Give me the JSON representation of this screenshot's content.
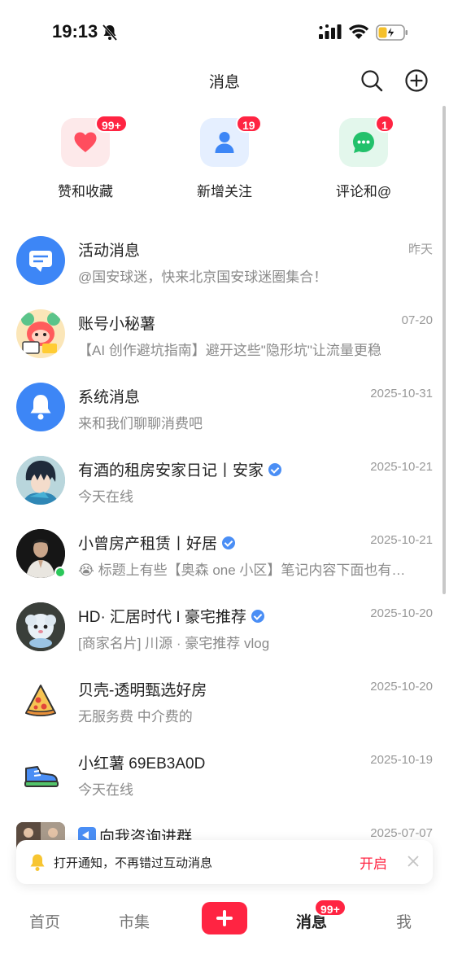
{
  "status_bar": {
    "time": "19:13"
  },
  "header": {
    "title": "消息"
  },
  "quick_actions": [
    {
      "label": "赞和收藏",
      "badge": "99+",
      "icon": "heart-icon",
      "color": "#ff4d5e"
    },
    {
      "label": "新增关注",
      "badge": "19",
      "icon": "person-icon",
      "color": "#3d86f6"
    },
    {
      "label": "评论和@",
      "badge": "1",
      "icon": "chat-bubble-icon",
      "color": "#23c16b"
    }
  ],
  "messages": [
    {
      "name": "活动消息",
      "time": "昨天",
      "preview": "@国安球迷，快来北京国安球迷圈集合！",
      "avatar": "megaphone-icon",
      "verified": false
    },
    {
      "name": "账号小秘薯",
      "time": "07-20",
      "preview": "【AI 创作避坑指南】避开这些\"隐形坑\"让流量更稳",
      "avatar": "mascot-avatar",
      "verified": false
    },
    {
      "name": "系统消息",
      "time": "2025-10-31",
      "preview": "来和我们聊聊消费吧",
      "avatar": "bell-icon",
      "verified": false
    },
    {
      "name": "有酒的租房安家日记丨安家",
      "time": "2025-10-21",
      "preview": "今天在线",
      "avatar": "anime-avatar",
      "verified": true
    },
    {
      "name": "小曾房产租赁丨好居",
      "time": "2025-10-21",
      "preview": "标题上有些【奥森 one 小区】笔记内容下面也有…",
      "avatar": "person-photo-avatar",
      "verified": true,
      "online": true,
      "preview_emoji": "😭"
    },
    {
      "name": "HD· 汇居时代 I 豪宅推荐",
      "time": "2025-10-20",
      "preview": "[商家名片] 川源 · 豪宅推荐 vlog",
      "avatar": "fluffy-pet-avatar",
      "verified": true
    },
    {
      "name": "贝壳-透明甄选好房",
      "time": "2025-10-20",
      "preview": "无服务费 中介费的",
      "avatar": "pizza-icon",
      "verified": false
    },
    {
      "name": "小红薯 69EB3A0D",
      "time": "2025-10-19",
      "preview": "今天在线",
      "avatar": "sneaker-icon",
      "verified": false
    },
    {
      "name": "向我咨询进群",
      "time": "2025-07-07",
      "preview": "",
      "avatar": "group-avatar",
      "verified": false
    }
  ],
  "notification": {
    "text": "打开通知，不再错过互动消息",
    "action": "开启"
  },
  "tabbar": {
    "home": "首页",
    "market": "市集",
    "messages": "消息",
    "messages_badge": "99+",
    "me": "我"
  },
  "colors": {
    "accent": "#ff2442",
    "blue": "#4a8ef5",
    "online": "#2bc75a"
  }
}
